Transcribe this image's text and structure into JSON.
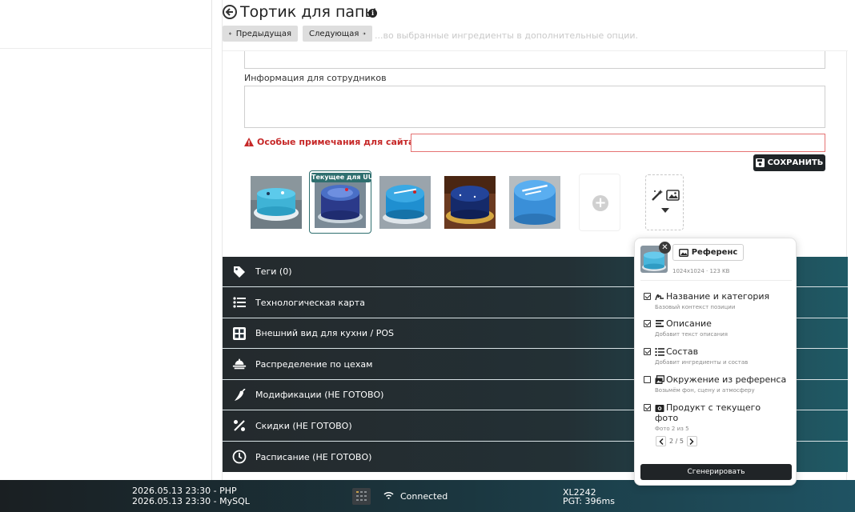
{
  "header": {
    "title": "Тортик для папы",
    "prev_label": "Предыдущая",
    "next_label": "Следующая",
    "hidden_hint": "...во выбранные ингредиенты в дополнительные опции."
  },
  "form": {
    "staff_info_label": "Информация для сотрудников",
    "site_notes_label": "Особые примечания для сайта!",
    "save_label": "СОХРАНИТЬ"
  },
  "gallery": {
    "current_badge": "Текущее для UU",
    "images": [
      {
        "icon": "cake-photo-1"
      },
      {
        "icon": "cake-photo-2",
        "selected": true
      },
      {
        "icon": "cake-photo-3"
      },
      {
        "icon": "cake-photo-4"
      },
      {
        "icon": "cake-photo-5"
      }
    ]
  },
  "sections": [
    {
      "label": "Теги (0)",
      "icon": "tag-icon"
    },
    {
      "label": "Технологическая карта",
      "icon": "list-icon"
    },
    {
      "label": "Внешний вид для кухни / POS",
      "icon": "grid-icon"
    },
    {
      "label": "Распределение по цехам",
      "icon": "workshop-icon"
    },
    {
      "label": "Модификации (НЕ ГОТОВО)",
      "icon": "pepper-icon"
    },
    {
      "label": "Скидки (НЕ ГОТОВО)",
      "icon": "percent-icon"
    },
    {
      "label": "Расписание (НЕ ГОТОВО)",
      "icon": "clock-icon"
    }
  ],
  "popup": {
    "reference_label": "Референс",
    "image_meta": "1024x1024 · 123 KB",
    "options": [
      {
        "title": "Название и категория",
        "subtitle": "Базовый контекст позиции",
        "checked": true,
        "icon": "signature-icon"
      },
      {
        "title": "Описание",
        "subtitle": "Добавит текст описания",
        "checked": true,
        "icon": "text-lines-icon"
      },
      {
        "title": "Состав",
        "subtitle": "Добавит ингредиенты и состав",
        "checked": true,
        "icon": "list-icon"
      },
      {
        "title": "Окружение из референса",
        "subtitle": "Возьмём фон, сцену и атмосферу",
        "checked": false,
        "icon": "images-icon"
      },
      {
        "title": "Продукт с текущего",
        "title2": "фото",
        "subtitle": "Фото 2 из 5",
        "checked": true,
        "icon": "camera-icon"
      }
    ],
    "pager_text": "2 / 5",
    "generate_label": "Сгенерировать"
  },
  "footer": {
    "php_line": "2026.05.13 23:30 - PHP",
    "mysql_line": "2026.05.13 23:30 - MySQL",
    "status": "Connected",
    "host": "XL2242",
    "pgt": "PGT: 396ms"
  },
  "colors": {
    "accent_teal": "#2f6f6f",
    "warning_red": "#c62828",
    "dark_button": "#1f2427"
  }
}
